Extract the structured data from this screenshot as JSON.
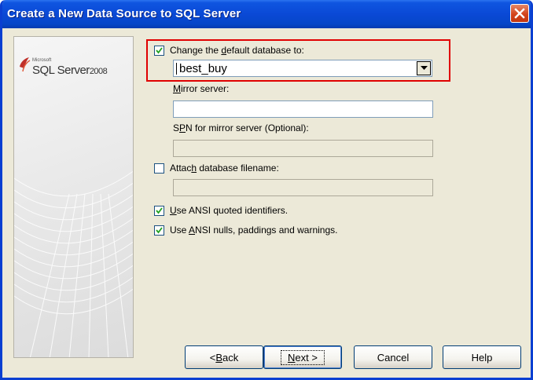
{
  "window": {
    "title": "Create a New Data Source to SQL Server"
  },
  "side_panel": {
    "logo_microsoft": "Microsoft",
    "logo_product": "SQL Server",
    "logo_version": "2008"
  },
  "form": {
    "default_db": {
      "checked": true,
      "label_pre": "Change the ",
      "label_accel": "d",
      "label_post": "efault database to:",
      "value": "best_buy"
    },
    "mirror_server": {
      "label_accel": "M",
      "label_rest": "irror server:",
      "value": ""
    },
    "spn": {
      "label_pre": "S",
      "label_accel": "P",
      "label_post": "N for mirror server (Optional):",
      "value": ""
    },
    "attach_db": {
      "checked": false,
      "label_pre": "Attac",
      "label_accel": "h",
      "label_post": " database filename:",
      "value": ""
    },
    "ansi_quoted": {
      "checked": true,
      "label_accel": "U",
      "label_rest": "se ANSI quoted identifiers."
    },
    "ansi_nulls": {
      "checked": true,
      "label_pre": "Use ",
      "label_accel": "A",
      "label_post": "NSI nulls, paddings and warnings."
    }
  },
  "buttons": {
    "back_pre": "< ",
    "back_accel": "B",
    "back_post": "ack",
    "next_accel": "N",
    "next_post": "ext >",
    "cancel": "Cancel",
    "help": "Help"
  },
  "colors": {
    "title_bar": "#0a49d6",
    "dialog_bg": "#ece9d8",
    "highlight_box": "#e00000",
    "close_button": "#d3441d"
  }
}
